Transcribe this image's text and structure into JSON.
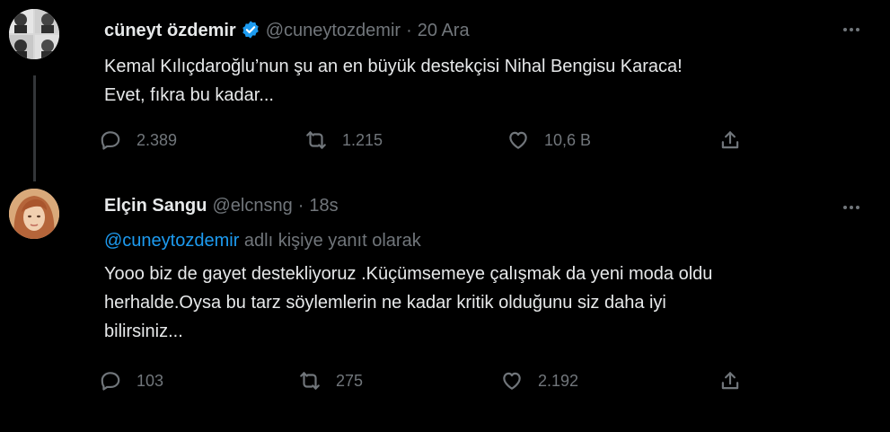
{
  "tweets": [
    {
      "name": "cüneyt özdemir",
      "handle": "@cuneytozdemir",
      "separator": "·",
      "time": "20 Ara",
      "lines": [
        "Kemal Kılıçdaroğlu’nun şu an en büyük destekçisi Nihal Bengisu Karaca!",
        "Evet, fıkra bu kadar..."
      ],
      "counts": {
        "replies": "2.389",
        "retweets": "1.215",
        "likes": "10,6 B"
      }
    },
    {
      "name": "Elçin Sangu",
      "handle": "@elcnsng",
      "separator": "·",
      "time": "18s",
      "reply_to_handle": "@cuneytozdemir",
      "reply_to_suffix": " adlı kişiye yanıt olarak",
      "lines": [
        "Yooo biz de gayet destekliyoruz .Küçümsemeye çalışmak da yeni moda oldu",
        "herhalde.Oysa bu tarz söylemlerin ne kadar kritik olduğunu siz daha iyi",
        "bilirsiniz..."
      ],
      "counts": {
        "replies": "103",
        "retweets": "275",
        "likes": "2.192"
      }
    }
  ],
  "colors": {
    "background": "#000000",
    "text": "#e7e9ea",
    "secondary": "#71767b",
    "link": "#1d9bf0",
    "verified": "#1d9bf0"
  }
}
